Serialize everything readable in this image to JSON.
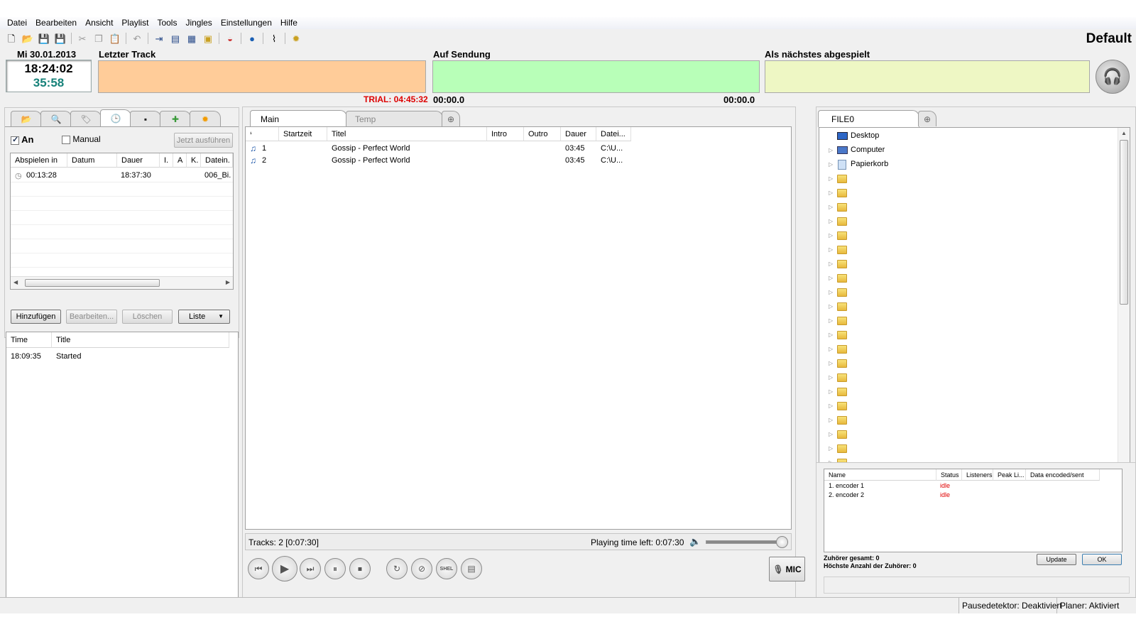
{
  "menu": [
    "Datei",
    "Bearbeiten",
    "Ansicht",
    "Playlist",
    "Tools",
    "Jingles",
    "Einstellungen",
    "Hilfe"
  ],
  "toolbar_icons": [
    "new-file-icon",
    "open-folder-icon",
    "save-icon",
    "save-as-icon",
    "cut-icon",
    "copy-icon",
    "paste-icon",
    "undo-icon",
    "playlist-insert-icon",
    "playlist-append-icon",
    "playlist-multi-icon",
    "playlist-folder-icon",
    "stream-icon",
    "globe-icon",
    "cursor-icon",
    "settings-gear-icon"
  ],
  "profile": "Default",
  "clock": {
    "date": "Mi 30.01.2013",
    "time": "18:24:02",
    "countdown": "35:58"
  },
  "panels": {
    "last_track": "Letzter Track",
    "on_air": "Auf Sendung",
    "next": "Als nächstes abgespielt",
    "trial": "TRIAL: 04:45:32",
    "onair_elapsed": "00:00.0",
    "onair_remaining": "00:00.0"
  },
  "colors": {
    "last_track": "#ffcc99",
    "on_air": "#b8ffb8",
    "next": "#eef7c4",
    "trial": "#d00000",
    "countdown": "#17827a",
    "encoder_idle": "#e00000"
  },
  "left_tabs": [
    "folder-icon",
    "search-icon",
    "tag-icon",
    "clock-icon",
    "calculator-icon",
    "puzzle-icon",
    "gear-icon"
  ],
  "scheduler": {
    "on_label": "An",
    "manual_label": "Manual",
    "run_now": "Jetzt ausführen",
    "columns": [
      "Abspielen in",
      "Datum",
      "Dauer",
      "I.",
      "A",
      "K.",
      "Datein."
    ],
    "rows": [
      {
        "play_in": "00:13:28",
        "date": "",
        "duration": "18:37:30",
        "i": "",
        "a": "",
        "k": "",
        "file": "006_Bi."
      }
    ],
    "buttons": {
      "add": "Hinzufügen",
      "edit": "Bearbeiten...",
      "delete": "Löschen",
      "list": "Liste"
    }
  },
  "log": {
    "columns": [
      "Time",
      "Title"
    ],
    "rows": [
      {
        "time": "18:09:35",
        "title": "Started"
      }
    ]
  },
  "playlist": {
    "tabs": [
      "Main",
      "Temp"
    ],
    "columns": [
      "¹",
      "Startzeit",
      "Titel",
      "Intro",
      "Outro",
      "Dauer",
      "Datei..."
    ],
    "rows": [
      {
        "num": "1",
        "start": "",
        "title": "Gossip - Perfect World",
        "intro": "",
        "outro": "",
        "duration": "03:45",
        "file": "C:\\U..."
      },
      {
        "num": "2",
        "start": "",
        "title": "Gossip - Perfect World",
        "intro": "",
        "outro": "",
        "duration": "03:45",
        "file": "C:\\U..."
      }
    ],
    "tracks_info": "Tracks: 2 [0:07:30]",
    "time_left": "Playing time left: 0:07:30",
    "volume": 1.0,
    "mic_label": "MIC",
    "shel_label": "SHEL"
  },
  "files": {
    "tab": "FILE0",
    "tree": [
      {
        "name": "Desktop",
        "icon": "desktop-icon"
      },
      {
        "name": "Computer",
        "icon": "computer-icon"
      },
      {
        "name": "Papierkorb",
        "icon": "recycle-bin-icon"
      }
    ]
  },
  "encoders": {
    "columns": [
      "Name",
      "Status",
      "Listeners",
      "Peak Li...",
      "Data encoded/sent"
    ],
    "rows": [
      {
        "name": "1. encoder 1",
        "status": "idle"
      },
      {
        "name": "2. encoder 2",
        "status": "idle"
      }
    ],
    "listeners_total": "Zuhörer gesamt:  0",
    "max_listeners": "Höchste Anzahl der Zuhörer:  0",
    "update": "Update",
    "ok": "OK"
  },
  "statusbar": {
    "pause": "Pausedetektor: Deaktiviert",
    "planner": "Planer: Aktiviert"
  }
}
